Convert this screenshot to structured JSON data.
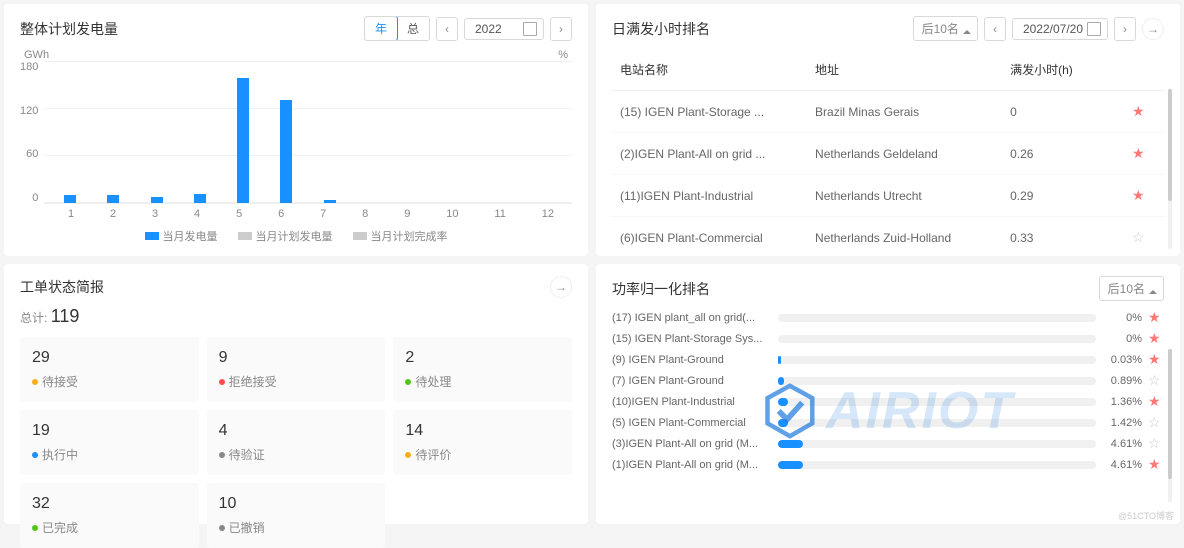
{
  "panel1": {
    "title": "整体计划发电量",
    "toggle": {
      "year": "年",
      "total": "总"
    },
    "year_value": "2022",
    "y_unit": "GWh",
    "pct_unit": "%",
    "legend": [
      "当月发电量",
      "当月计划发电量",
      "当月计划完成率"
    ],
    "legend_colors": [
      "#1890ff",
      "#cccccc",
      "#cccccc"
    ]
  },
  "chart_data": {
    "type": "bar",
    "categories": [
      "1",
      "2",
      "3",
      "4",
      "5",
      "6",
      "7",
      "8",
      "9",
      "10",
      "11",
      "12"
    ],
    "series": [
      {
        "name": "当月发电量",
        "values": [
          10,
          10,
          8,
          12,
          158,
          130,
          4,
          0,
          0,
          0,
          0,
          0
        ]
      }
    ],
    "ylabel": "GWh",
    "ylim": [
      0,
      180
    ],
    "yticks": [
      0,
      60,
      120,
      180
    ]
  },
  "panel2": {
    "title": "日满发小时排名",
    "filter_label": "后10名",
    "date_value": "2022/07/20",
    "columns": [
      "电站名称",
      "地址",
      "满发小时(h)"
    ],
    "rows": [
      {
        "name": "(15) IGEN Plant-Storage ...",
        "addr": "Brazil Minas Gerais",
        "hours": "0",
        "starred": true
      },
      {
        "name": "(2)IGEN Plant-All on grid ...",
        "addr": "Netherlands Geldeland",
        "hours": "0.26",
        "starred": true
      },
      {
        "name": "(11)IGEN Plant-Industrial",
        "addr": "Netherlands Utrecht",
        "hours": "0.29",
        "starred": true
      },
      {
        "name": "(6)IGEN Plant-Commercial",
        "addr": "Netherlands Zuid-Holland",
        "hours": "0.33",
        "starred": false
      }
    ]
  },
  "panel3": {
    "title": "工单状态简报",
    "total_label": "总计:",
    "total_value": "119",
    "items": [
      {
        "num": "29",
        "label": "待接受",
        "color": "#faad14"
      },
      {
        "num": "9",
        "label": "拒绝接受",
        "color": "#ff4d4f"
      },
      {
        "num": "2",
        "label": "待处理",
        "color": "#52c41a"
      },
      {
        "num": "19",
        "label": "执行中",
        "color": "#1890ff"
      },
      {
        "num": "4",
        "label": "待验证",
        "color": "#888888"
      },
      {
        "num": "14",
        "label": "待评价",
        "color": "#faad14"
      },
      {
        "num": "32",
        "label": "已完成",
        "color": "#52c41a"
      },
      {
        "num": "10",
        "label": "已撤销",
        "color": "#888888"
      }
    ]
  },
  "panel4": {
    "title": "功率归一化排名",
    "filter_label": "后10名",
    "rows": [
      {
        "name": "(17) IGEN plant_all on grid(...",
        "pct": "0%",
        "bar": 0,
        "starred": true
      },
      {
        "name": "(15) IGEN Plant-Storage Sys...",
        "pct": "0%",
        "bar": 0,
        "starred": true
      },
      {
        "name": "(9) IGEN Plant-Ground",
        "pct": "0.03%",
        "bar": 1,
        "starred": true
      },
      {
        "name": "(7) IGEN Plant-Ground",
        "pct": "0.89%",
        "bar": 2,
        "starred": false
      },
      {
        "name": "(10)IGEN Plant-Industrial",
        "pct": "1.36%",
        "bar": 3,
        "starred": true
      },
      {
        "name": "(5) IGEN Plant-Commercial",
        "pct": "1.42%",
        "bar": 3,
        "starred": false
      },
      {
        "name": "(3)IGEN Plant-All on grid (M...",
        "pct": "4.61%",
        "bar": 8,
        "starred": false
      },
      {
        "name": "(1)IGEN Plant-All on grid (M...",
        "pct": "4.61%",
        "bar": 8,
        "starred": true
      }
    ],
    "watermark": "AIRIOT",
    "credit": "@51CTO博客"
  }
}
